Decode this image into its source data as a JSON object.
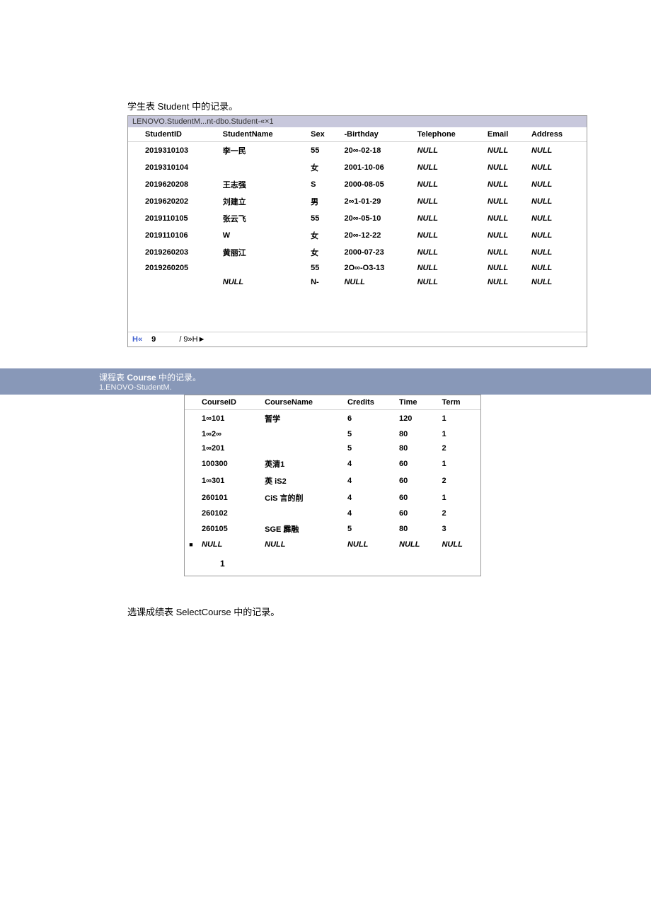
{
  "section1": {
    "caption_cn_prefix": "学生表 ",
    "caption_en": "Student",
    "caption_cn_suffix": " 中的记录。",
    "tab": "LENOVO.StudentM...nt-dbo.Student-«×1",
    "headers": [
      "StudentID",
      "StudentName",
      "Sex",
      "-Birthday",
      "Telephone",
      "Email",
      "Address"
    ],
    "rows": [
      [
        "2019310103",
        "李一民",
        "55",
        "20∞-02-18",
        "NULL",
        "NULL",
        "NULL"
      ],
      [
        "2019310104",
        "",
        "女",
        "2001-10-06",
        "NULL",
        "NULL",
        "NULL"
      ],
      [
        "2019620208",
        "王志强",
        "S",
        "2000-08-05",
        "NULL",
        "NULL",
        "NULL"
      ],
      [
        "2019620202",
        "刘建立",
        "男",
        "2∞1-01-29",
        "NULL",
        "NULL",
        "NULL"
      ],
      [
        "2019110105",
        "张云飞",
        "55",
        "20∞-05-10",
        "NULL",
        "NULL",
        "NULL"
      ],
      [
        "2019110106",
        "W",
        "女",
        "20∞-12-22",
        "NULL",
        "NULL",
        "NULL"
      ],
      [
        "2019260203",
        "黄丽江",
        "女",
        "2000-07-23",
        "NULL",
        "NULL",
        "NULL"
      ],
      [
        "2019260205",
        "",
        "55",
        "2O∞-O3-13",
        "NULL",
        "NULL",
        "NULL"
      ],
      [
        "",
        "NULL",
        "N-",
        "NULL",
        "NULL",
        "NULL",
        "NULL"
      ]
    ],
    "pager_left": "H«",
    "pager_mid": "9",
    "pager_right": "/ 9»H►"
  },
  "section2": {
    "bar_main_prefix_cn": "课程表 ",
    "bar_main_en": "Course",
    "bar_main_suffix_cn": " 中的记录。",
    "bar_sub": "1.ENOVO-StudentM.",
    "headers": [
      "CourseID",
      "CourseName",
      "Credits",
      "Time",
      "Term"
    ],
    "rows": [
      [
        "",
        "1∞101",
        "暂学",
        "6",
        "120",
        "1"
      ],
      [
        "",
        "1∞2∞",
        "",
        "5",
        "80",
        "1"
      ],
      [
        "",
        "1∞201",
        "",
        "5",
        "80",
        "2"
      ],
      [
        "",
        "100300",
        "英清1",
        "4",
        "60",
        "1"
      ],
      [
        "",
        "1∞301",
        "英 iS2",
        "4",
        "60",
        "2"
      ],
      [
        "",
        "260101",
        "CiS 言的削",
        "4",
        "60",
        "1"
      ],
      [
        "",
        "260102",
        "",
        "4",
        "60",
        "2"
      ],
      [
        "",
        "260105",
        "SGE 霹融",
        "5",
        "80",
        "3"
      ],
      [
        "■",
        "NULL",
        "NULL",
        "NULL",
        "NULL",
        "NULL"
      ]
    ],
    "footer_val": "1"
  },
  "section3": {
    "caption_cn_prefix": "选课成绩表 ",
    "caption_en": "SelectCourse",
    "caption_cn_suffix": " 中的记录。"
  }
}
